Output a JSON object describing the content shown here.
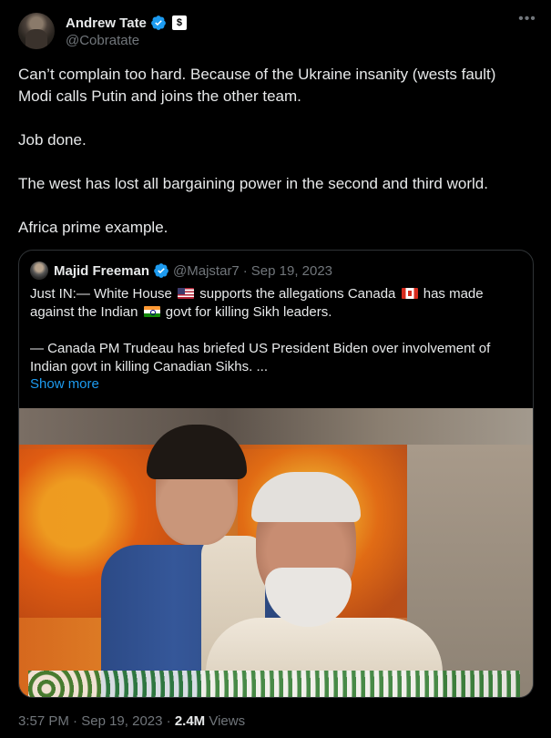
{
  "author": {
    "display_name": "Andrew Tate",
    "handle": "@Cobratate",
    "affiliate_badge": "$"
  },
  "tweet": {
    "paragraphs": [
      "Can’t complain too hard. Because of the Ukraine insanity (wests fault) Modi calls Putin and joins the other team.",
      "Job done.",
      "The west has lost all bargaining power in the second and third world.",
      "Africa prime example."
    ]
  },
  "quoted": {
    "display_name": "Majid Freeman",
    "handle": "@Majstar7",
    "separator": "·",
    "date": "Sep 19, 2023",
    "line1_a": "Just IN:— White House",
    "line1_b": "supports the allegations Canada",
    "line1_c": "has made",
    "line2_a": "against the Indian",
    "line2_b": "govt for killing Sikh leaders.",
    "paragraph2": "— Canada PM Trudeau has briefed US President Biden over involvement of Indian govt in killing Canadian Sikhs. ...",
    "show_more": "Show more"
  },
  "meta": {
    "time": "3:57 PM",
    "separator": "·",
    "date": "Sep 19, 2023",
    "views_count": "2.4M",
    "views_label": "Views"
  },
  "colors": {
    "background": "#000000",
    "text": "#e7e9ea",
    "secondary": "#71767b",
    "accent": "#1d9bf0",
    "border": "#2f3336"
  },
  "icons": [
    "verified-badge-icon",
    "more-options-icon",
    "flag-us-icon",
    "flag-canada-icon",
    "flag-india-icon"
  ]
}
